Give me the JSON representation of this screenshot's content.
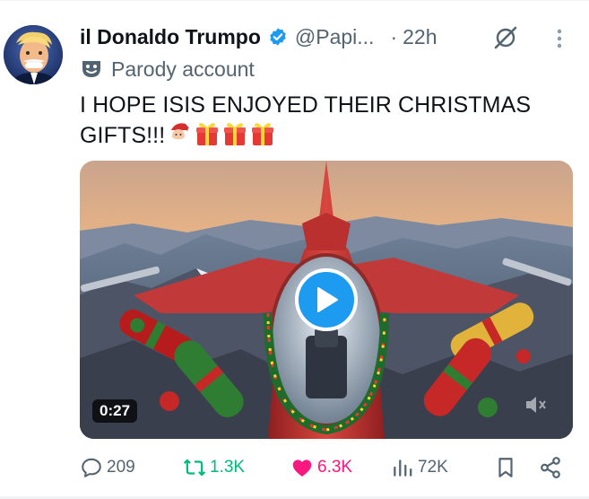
{
  "tweet": {
    "display_name": "il Donaldo Trumpo",
    "handle": "@Papi...",
    "separator": "·",
    "time": "22h",
    "label": "Parody account",
    "text": "I HOPE ISIS ENJOYED THEIR CHRISTMAS GIFTS!!!",
    "emojis": [
      "santa-emoji",
      "gift-emoji",
      "gift-emoji",
      "gift-emoji"
    ]
  },
  "media": {
    "type": "video",
    "duration": "0:27"
  },
  "actions": {
    "replies": "209",
    "reposts": "1.3K",
    "likes": "6.3K",
    "views": "72K"
  },
  "colors": {
    "verified": "#1d9bf0",
    "play_button": "#1d9bf0",
    "repost_active": "#00ba7c",
    "like_active": "#f91880",
    "muted_text": "#536471"
  }
}
